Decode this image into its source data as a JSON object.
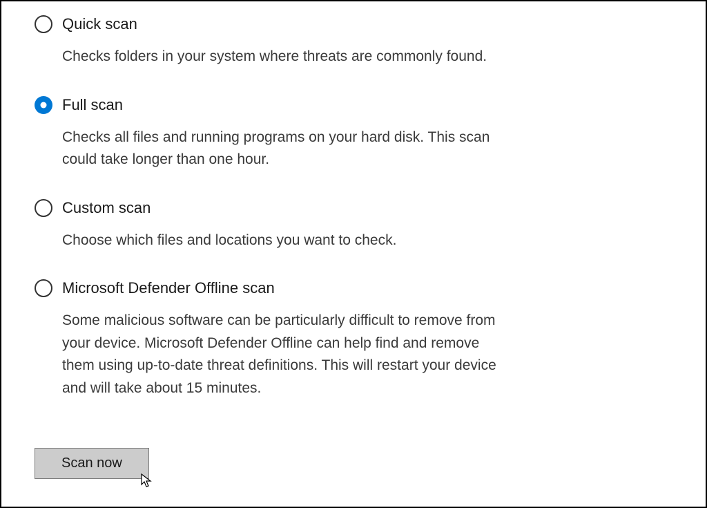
{
  "colors": {
    "accent": "#0078d4",
    "border": "#000000",
    "text": "#1a1a1a",
    "description": "#3a3a3a",
    "buttonBg": "#cccccc",
    "buttonBorder": "#7a7a7a"
  },
  "options": {
    "quick": {
      "label": "Quick scan",
      "description": "Checks folders in your system where threats are commonly found.",
      "selected": false
    },
    "full": {
      "label": "Full scan",
      "description": "Checks all files and running programs on your hard disk. This scan could take longer than one hour.",
      "selected": true
    },
    "custom": {
      "label": "Custom scan",
      "description": "Choose which files and locations you want to check.",
      "selected": false
    },
    "offline": {
      "label": "Microsoft Defender Offline scan",
      "description": "Some malicious software can be particularly difficult to remove from your device. Microsoft Defender Offline can help find and remove them using up-to-date threat definitions. This will restart your device and will take about 15 minutes.",
      "selected": false
    }
  },
  "button": {
    "label": "Scan now"
  }
}
